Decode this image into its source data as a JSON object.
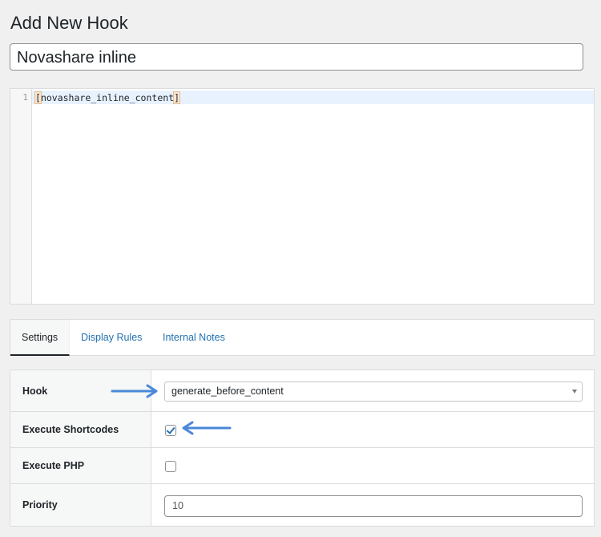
{
  "page": {
    "title": "Add New Hook"
  },
  "hook_title": {
    "value": "Novashare inline"
  },
  "code_editor": {
    "line_numbers": [
      "1"
    ],
    "lines": [
      "novashare_inline_content"
    ],
    "bracket_open": "[",
    "bracket_close": "]"
  },
  "tabs": [
    {
      "label": "Settings",
      "active": true
    },
    {
      "label": "Display Rules",
      "active": false
    },
    {
      "label": "Internal Notes",
      "active": false
    }
  ],
  "settings": {
    "hook": {
      "label": "Hook",
      "value": "generate_before_content"
    },
    "execute_shortcodes": {
      "label": "Execute Shortcodes",
      "checked": true
    },
    "execute_php": {
      "label": "Execute PHP",
      "checked": false
    },
    "priority": {
      "label": "Priority",
      "value": "10"
    }
  },
  "annotations": {
    "arrow_color": "#4a88d9"
  },
  "colors": {
    "link": "#2271b1",
    "background": "#f0f0f1"
  }
}
